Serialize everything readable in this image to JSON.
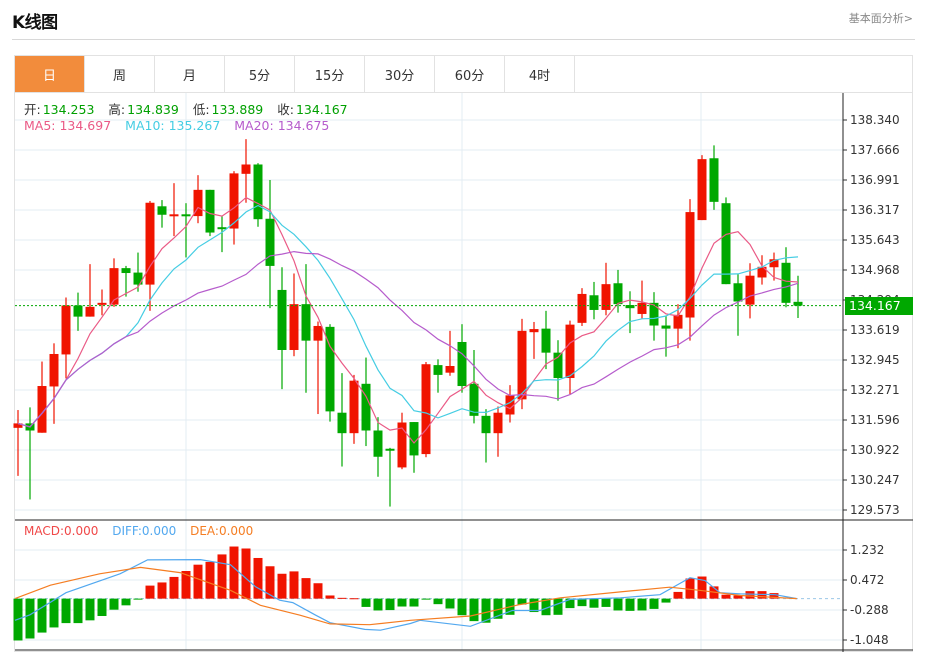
{
  "header": {
    "title": "K线图",
    "link": "基本面分析>"
  },
  "tabs": [
    {
      "label": "日",
      "active": true
    },
    {
      "label": "周",
      "active": false
    },
    {
      "label": "月",
      "active": false
    },
    {
      "label": "5分",
      "active": false
    },
    {
      "label": "15分",
      "active": false
    },
    {
      "label": "30分",
      "active": false
    },
    {
      "label": "60分",
      "active": false
    },
    {
      "label": "4时",
      "active": false
    }
  ],
  "ohlc": {
    "open_label": "开:",
    "open": "134.253",
    "high_label": "高:",
    "high": "134.839",
    "low_label": "低:",
    "low": "133.889",
    "close_label": "收:",
    "close": "134.167"
  },
  "ma": {
    "ma5": "MA5: 134.697",
    "ma10": "MA10: 135.267",
    "ma20": "MA20: 134.675"
  },
  "macd_legend": {
    "macd": "MACD:0.000",
    "diff": "DIFF:0.000",
    "dea": "DEA:0.000"
  },
  "colors": {
    "up": "#f01400",
    "down": "#00a800",
    "ma5": "#ea5a86",
    "ma10": "#45cde3",
    "ma20": "#b65ccc",
    "diff": "#52a8ef",
    "dea": "#f57d22",
    "macd_label": "#f04848",
    "accent": "#f28c3c"
  },
  "chart_data": [
    {
      "type": "candlestick",
      "yticks": [
        "138.340",
        "137.666",
        "136.991",
        "136.317",
        "135.643",
        "134.968",
        "134.294",
        "133.619",
        "132.945",
        "132.271",
        "131.596",
        "130.922",
        "130.247",
        "129.573"
      ],
      "ylim": [
        129.573,
        138.34
      ],
      "last_price": "134.167",
      "candles": [
        [
          131.42,
          131.82,
          130.34,
          131.52
        ],
        [
          131.52,
          131.88,
          129.81,
          131.36
        ],
        [
          131.31,
          132.91,
          131.31,
          132.36
        ],
        [
          132.35,
          133.32,
          131.51,
          133.08
        ],
        [
          133.07,
          134.35,
          132.53,
          134.17
        ],
        [
          134.17,
          134.46,
          133.6,
          133.92
        ],
        [
          133.92,
          135.1,
          133.92,
          134.14
        ],
        [
          134.19,
          134.53,
          133.95,
          134.23
        ],
        [
          134.19,
          135.23,
          134.14,
          135.01
        ],
        [
          135.01,
          135.06,
          134.37,
          134.9
        ],
        [
          134.91,
          135.36,
          134.48,
          134.64
        ],
        [
          134.64,
          136.52,
          134.05,
          136.48
        ],
        [
          136.4,
          136.54,
          135.92,
          136.21
        ],
        [
          136.21,
          136.92,
          135.73,
          136.22
        ],
        [
          136.22,
          136.47,
          135.25,
          136.18
        ],
        [
          136.18,
          137.1,
          136.02,
          136.77
        ],
        [
          136.77,
          136.77,
          135.73,
          135.81
        ],
        [
          135.93,
          136.18,
          135.37,
          135.92
        ],
        [
          135.9,
          137.19,
          135.54,
          137.14
        ],
        [
          137.13,
          137.91,
          136.48,
          137.34
        ],
        [
          137.34,
          137.37,
          135.94,
          136.11
        ],
        [
          136.12,
          136.99,
          134.11,
          135.06
        ],
        [
          134.52,
          135.03,
          132.29,
          133.17
        ],
        [
          133.17,
          134.89,
          133.03,
          134.2
        ],
        [
          134.2,
          135.1,
          132.21,
          133.38
        ],
        [
          133.38,
          133.81,
          131.73,
          133.71
        ],
        [
          133.69,
          133.75,
          131.56,
          131.79
        ],
        [
          131.76,
          132.65,
          130.55,
          131.3
        ],
        [
          131.3,
          132.61,
          131.06,
          132.48
        ],
        [
          132.41,
          133.0,
          131.01,
          131.36
        ],
        [
          131.36,
          131.66,
          130.32,
          130.77
        ],
        [
          130.95,
          130.97,
          129.65,
          130.93
        ],
        [
          130.53,
          131.76,
          130.49,
          131.54
        ],
        [
          131.55,
          131.55,
          130.41,
          130.8
        ],
        [
          130.83,
          132.9,
          130.76,
          132.85
        ],
        [
          132.83,
          132.96,
          132.21,
          132.61
        ],
        [
          132.66,
          133.6,
          132.59,
          132.81
        ],
        [
          133.35,
          133.75,
          132.21,
          132.36
        ],
        [
          132.41,
          133.17,
          131.52,
          131.69
        ],
        [
          131.69,
          131.84,
          130.64,
          131.3
        ],
        [
          131.3,
          131.9,
          130.77,
          131.76
        ],
        [
          131.72,
          132.38,
          131.54,
          132.15
        ],
        [
          132.06,
          133.87,
          131.84,
          133.6
        ],
        [
          133.57,
          133.8,
          132.97,
          133.64
        ],
        [
          133.65,
          134.05,
          132.74,
          133.11
        ],
        [
          133.11,
          133.39,
          132.03,
          132.54
        ],
        [
          132.54,
          133.83,
          132.18,
          133.74
        ],
        [
          133.78,
          134.56,
          133.71,
          134.43
        ],
        [
          134.4,
          134.7,
          133.86,
          134.07
        ],
        [
          134.07,
          135.13,
          133.95,
          134.65
        ],
        [
          134.67,
          134.97,
          134.01,
          134.2
        ],
        [
          134.18,
          134.49,
          133.55,
          134.11
        ],
        [
          133.98,
          134.73,
          133.88,
          134.23
        ],
        [
          134.23,
          134.47,
          133.38,
          133.72
        ],
        [
          133.72,
          133.93,
          133.02,
          133.65
        ],
        [
          133.65,
          134.2,
          133.21,
          133.96
        ],
        [
          133.9,
          136.56,
          133.38,
          136.27
        ],
        [
          136.09,
          137.55,
          136.09,
          137.46
        ],
        [
          137.48,
          137.77,
          136.32,
          136.5
        ],
        [
          136.47,
          136.6,
          134.65,
          134.65
        ],
        [
          134.67,
          134.88,
          133.49,
          134.26
        ],
        [
          134.19,
          135.12,
          133.88,
          134.84
        ],
        [
          134.8,
          135.3,
          134.64,
          135.04
        ],
        [
          135.03,
          135.36,
          134.73,
          135.21
        ],
        [
          135.13,
          135.48,
          134.13,
          134.23
        ],
        [
          134.253,
          134.839,
          133.889,
          134.167
        ]
      ],
      "ma_periods": [
        5,
        10,
        20
      ]
    },
    {
      "type": "bar+line",
      "yticks": [
        "1.232",
        "0.472",
        "-0.288",
        "-1.048"
      ],
      "ylim": [
        -1.3,
        1.6
      ],
      "macd": [
        -1.06,
        -1.01,
        -0.86,
        -0.73,
        -0.62,
        -0.62,
        -0.55,
        -0.44,
        -0.28,
        -0.17,
        -0.01,
        0.33,
        0.41,
        0.55,
        0.7,
        0.86,
        0.93,
        1.12,
        1.32,
        1.27,
        1.03,
        0.82,
        0.63,
        0.69,
        0.52,
        0.39,
        0.08,
        0.02,
        0.01,
        -0.21,
        -0.3,
        -0.29,
        -0.2,
        -0.2,
        -0.02,
        -0.14,
        -0.25,
        -0.42,
        -0.57,
        -0.61,
        -0.51,
        -0.41,
        -0.15,
        -0.34,
        -0.42,
        -0.41,
        -0.24,
        -0.19,
        -0.23,
        -0.21,
        -0.3,
        -0.31,
        -0.3,
        -0.26,
        -0.1,
        0.17,
        0.51,
        0.56,
        0.31,
        0.1,
        0.08,
        0.19,
        0.19,
        0.14,
        0.0,
        0.0
      ],
      "diff": [
        [
          -0.25,
          -0.55
        ],
        [
          1,
          -0.41
        ],
        [
          4,
          0.15
        ],
        [
          8.5,
          0.63
        ],
        [
          10.8,
          0.98
        ],
        [
          15.2,
          0.99
        ],
        [
          17.7,
          0.86
        ],
        [
          19.8,
          0.3
        ],
        [
          21.8,
          -0.04
        ],
        [
          22.9,
          -0.1
        ],
        [
          24.75,
          -0.41
        ],
        [
          26,
          -0.61
        ],
        [
          28.9,
          -0.78
        ],
        [
          30.2,
          -0.8
        ],
        [
          32.7,
          -0.63
        ],
        [
          33.5,
          -0.55
        ],
        [
          37.7,
          -0.7
        ],
        [
          41.2,
          -0.3
        ],
        [
          43.5,
          -0.3
        ],
        [
          46,
          -0.02
        ],
        [
          50.2,
          0.02
        ],
        [
          53.5,
          0.1
        ],
        [
          56,
          0.53
        ],
        [
          57.25,
          0.46
        ],
        [
          58.5,
          0.15
        ],
        [
          60.2,
          0.12
        ],
        [
          63.1,
          0.1
        ],
        [
          64.9,
          0
        ]
      ],
      "dea": [
        [
          -0.25,
          0
        ],
        [
          2.7,
          0.34
        ],
        [
          6.8,
          0.63
        ],
        [
          10.2,
          0.79
        ],
        [
          13.5,
          0.66
        ],
        [
          17.7,
          0.21
        ],
        [
          20.2,
          -0.17
        ],
        [
          23.5,
          -0.42
        ],
        [
          26,
          -0.64
        ],
        [
          29.3,
          -0.66
        ],
        [
          32.7,
          -0.55
        ],
        [
          37.7,
          -0.44
        ],
        [
          41.8,
          -0.15
        ],
        [
          45.2,
          0.02
        ],
        [
          50.2,
          0.17
        ],
        [
          54.3,
          0.29
        ],
        [
          56.8,
          0.21
        ],
        [
          60.2,
          0.08
        ],
        [
          64.9,
          0
        ]
      ]
    }
  ]
}
